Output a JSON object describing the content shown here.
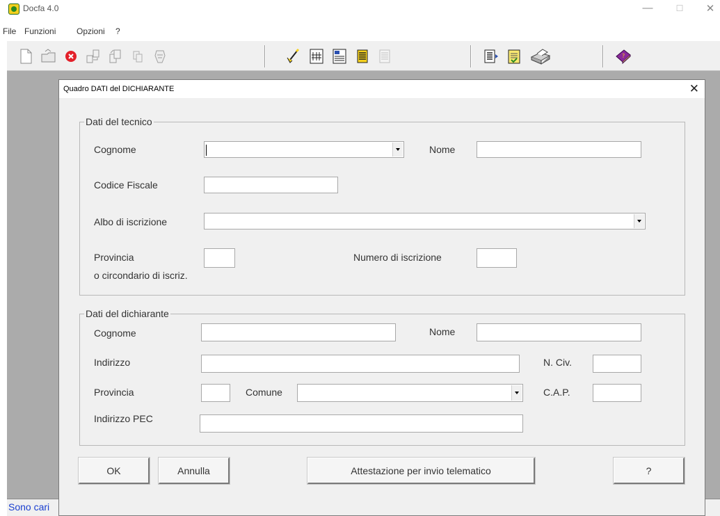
{
  "app": {
    "title": "Docfa 4.0",
    "minimize": "—",
    "maximize": "☐",
    "close": "✕"
  },
  "menu": {
    "file": "File",
    "funzioni": "Funzioni",
    "opzioni": "Opzioni",
    "help": "?"
  },
  "toolbar": {
    "icons": [
      "new-document-icon",
      "open-folder-icon",
      "delete-icon",
      "transfer-icon",
      "copy-icon",
      "paste-icon",
      "settings-icon",
      "check-icon",
      "form-icon",
      "grid-icon",
      "list-icon",
      "disabled-list-icon",
      "report-icon",
      "notes-icon",
      "printer-icon",
      "help-book-icon"
    ]
  },
  "status": {
    "text": "Sono cari"
  },
  "dialog": {
    "title": "Quadro DATI del DICHIARANTE",
    "close": "✕",
    "tecnico": {
      "legend": "Dati del tecnico",
      "cognome_label": "Cognome",
      "cognome_value": "",
      "nome_label": "Nome",
      "nome_value": "",
      "codice_fiscale_label": "Codice Fiscale",
      "codice_fiscale_value": "",
      "albo_label": "Albo di iscrizione",
      "albo_value": "",
      "provincia_label": "Provincia",
      "provincia_label2": "o circondario di iscriz.",
      "provincia_value": "",
      "numero_label": "Numero di iscrizione",
      "numero_value": ""
    },
    "dichiarante": {
      "legend": "Dati del dichiarante",
      "cognome_label": "Cognome",
      "cognome_value": "",
      "nome_label": "Nome",
      "nome_value": "",
      "indirizzo_label": "Indirizzo",
      "indirizzo_value": "",
      "civico_label": "N. Civ.",
      "civico_value": "",
      "provincia_label": "Provincia",
      "provincia_value": "",
      "comune_label": "Comune",
      "comune_value": "",
      "cap_label": "C.A.P.",
      "cap_value": "",
      "pec_label": "Indirizzo PEC",
      "pec_value": ""
    },
    "buttons": {
      "ok": "OK",
      "annulla": "Annulla",
      "attestazione": "Attestazione per invio telematico",
      "help": "?"
    }
  }
}
